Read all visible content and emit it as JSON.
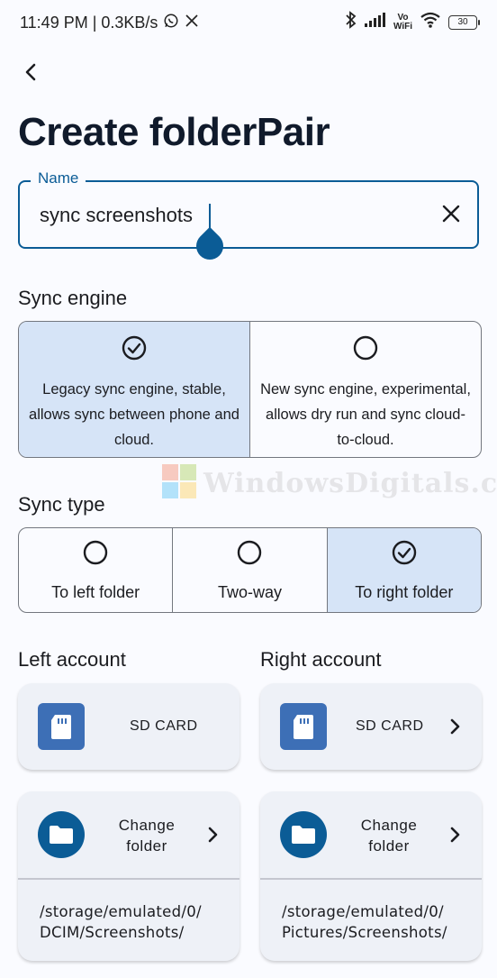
{
  "status": {
    "time_speed": "11:49 PM | 0.3KB/s",
    "vowifi_top": "Vo",
    "vowifi_bottom": "WiFi",
    "battery": "30"
  },
  "header": {
    "title": "Create folderPair"
  },
  "name_field": {
    "label": "Name",
    "value": "sync screenshots"
  },
  "sync_engine": {
    "heading": "Sync engine",
    "options": [
      {
        "text": "Legacy sync engine, stable, allows sync between phone and cloud.",
        "selected": true
      },
      {
        "text": "New sync engine, experimental, allows dry run and sync cloud-to-cloud.",
        "selected": false
      }
    ]
  },
  "sync_type": {
    "heading": "Sync type",
    "options": [
      {
        "label": "To left folder",
        "selected": false
      },
      {
        "label": "Two-way",
        "selected": false
      },
      {
        "label": "To right folder",
        "selected": true
      }
    ]
  },
  "left_account": {
    "heading": "Left account",
    "storage": "SD CARD",
    "change_line1": "Change",
    "change_line2": "folder",
    "path_line1": "/storage/emulated/0/",
    "path_line2": "DCIM/Screenshots/"
  },
  "right_account": {
    "heading": "Right account",
    "storage": "SD CARD",
    "change_line1": "Change",
    "change_line2": "folder",
    "path_line1": "/storage/emulated/0/",
    "path_line2": "Pictures/Screenshots/"
  },
  "watermark": {
    "text": "WindowsDigitals.com"
  },
  "colors": {
    "accent": "#0b5c96",
    "selected_bg": "#d6e4f7",
    "sd_icon": "#3d6fb6",
    "card_bg": "#eef1f7"
  },
  "icons": {
    "status": [
      "whatsapp-icon",
      "x-logo-icon",
      "bluetooth-icon",
      "signal-icon",
      "wifi-icon",
      "battery-icon"
    ],
    "back": "arrow-back-icon",
    "clear": "close-icon",
    "check": "check-circle-icon",
    "radio": "radio-unchecked-icon",
    "sd": "sd-card-icon",
    "folder": "folder-icon",
    "chevron": "chevron-right-icon"
  }
}
